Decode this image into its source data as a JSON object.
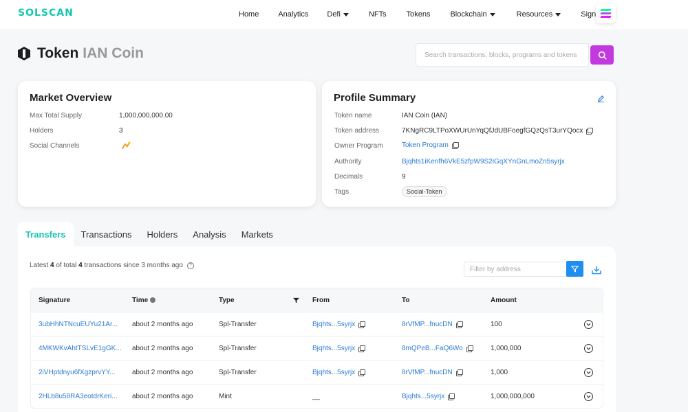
{
  "nav": {
    "logo": "SOLSCAN",
    "links": [
      {
        "label": "Home",
        "caret": false
      },
      {
        "label": "Analytics",
        "caret": false
      },
      {
        "label": "Defi",
        "caret": true
      },
      {
        "label": "NFTs",
        "caret": false
      },
      {
        "label": "Tokens",
        "caret": false
      },
      {
        "label": "Blockchain",
        "caret": true
      },
      {
        "label": "Resources",
        "caret": true
      },
      {
        "label": "Sign in",
        "caret": false
      }
    ],
    "sol_colors": [
      "#00ffa3",
      "#b34ee3",
      "#dc1fff"
    ]
  },
  "header": {
    "title": "Token",
    "subtitle": "IAN Coin",
    "search_placeholder": "Search transactions, blocks, programs and tokens",
    "accent": "#c239e0"
  },
  "market": {
    "title": "Market Overview",
    "max_supply_label": "Max Total Supply",
    "max_supply_value": "1,000,000,000.00",
    "holders_label": "Holders",
    "holders_value": "3",
    "social_label": "Social Channels"
  },
  "profile": {
    "title": "Profile Summary",
    "token_name_label": "Token name",
    "token_name_value": "IAN Coin (IAN)",
    "token_address_label": "Token address",
    "token_address_value": "7KNgRC9LTPoXWUrUnYqQfJdUBFoegfGQzQsT3urYQocx",
    "owner_label": "Owner Program",
    "owner_value": "Token Program",
    "authority_label": "Authority",
    "authority_value": "Bjqhts1iKenfh6VkE5zfpW9S2iGqXYnGnLmoZn5syrjx",
    "decimals_label": "Decimals",
    "decimals_value": "9",
    "tags_label": "Tags",
    "tag_value": "Social-Token"
  },
  "tabs": [
    "Transfers",
    "Transactions",
    "Holders",
    "Analysis",
    "Markets"
  ],
  "transfers": {
    "summary_prefix": "Latest ",
    "shown": "4",
    "summary_mid": " of total ",
    "total": "4",
    "summary_suffix": " transactions since 3 months ago",
    "filter_placeholder": "Filter by address",
    "columns": {
      "signature": "Signature",
      "time": "Time",
      "type": "Type",
      "from": "From",
      "to": "To",
      "amount": "Amount"
    },
    "rows": [
      {
        "signature": "3ubHhNTNcuEUYu21Ar...",
        "time": "about 2 months ago",
        "type": "Spl-Transfer",
        "from": "Bjqhts...5syrjx",
        "to": "8rVfMP...fnucDN",
        "amount": "100"
      },
      {
        "signature": "4MKWKvAhtTSLvE1gGK...",
        "time": "about 2 months ago",
        "type": "Spl-Transfer",
        "from": "Bjqhts...5syrjx",
        "to": "8mQPeB...FaQ6Wo",
        "amount": "1,000,000"
      },
      {
        "signature": "2iVHptdnyu6fXgzprvYY...",
        "time": "about 2 months ago",
        "type": "Spl-Transfer",
        "from": "Bjqhts...5syrjx",
        "to": "8rVfMP...fnucDN",
        "amount": "1,000"
      },
      {
        "signature": "2HLb8u58RA3eotdrKeri...",
        "time": "about 2 months ago",
        "type": "Mint",
        "from": "__",
        "to": "Bjqhts...5syrjx",
        "amount": "1,000,000,000"
      }
    ]
  }
}
